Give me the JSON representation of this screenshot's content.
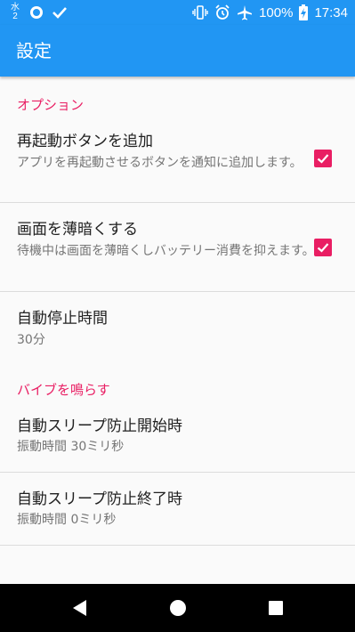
{
  "status_bar": {
    "weekday": "水",
    "day": "2",
    "battery": "100%",
    "time": "17:34",
    "icons": [
      "calendar-icon",
      "sync-circle-icon",
      "check-icon",
      "vibrate-icon",
      "alarm-icon",
      "airplane-icon",
      "battery-charging-icon"
    ]
  },
  "app_bar": {
    "title": "設定"
  },
  "categories": [
    {
      "title": "オプション"
    },
    {
      "title": "バイブを鳴らす"
    }
  ],
  "preferences": [
    {
      "title": "再起動ボタンを追加",
      "summary": "アプリを再起動させるボタンを通知に追加します。",
      "checked": true
    },
    {
      "title": "画面を薄暗くする",
      "summary": "待機中は画面を薄暗くしバッテリー消費を抑えます。",
      "checked": true
    },
    {
      "title": "自動停止時間",
      "summary": "30分"
    },
    {
      "title": "自動スリープ防止開始時",
      "summary": "振動時間 30ミリ秒"
    },
    {
      "title": "自動スリープ防止終了時",
      "summary": "振動時間 0ミリ秒"
    }
  ],
  "nav_bar": {
    "buttons": [
      "back-icon",
      "home-icon",
      "recents-icon"
    ]
  },
  "colors": {
    "primary": "#2196f3",
    "accent": "#e91e63",
    "background": "#fafafa"
  }
}
